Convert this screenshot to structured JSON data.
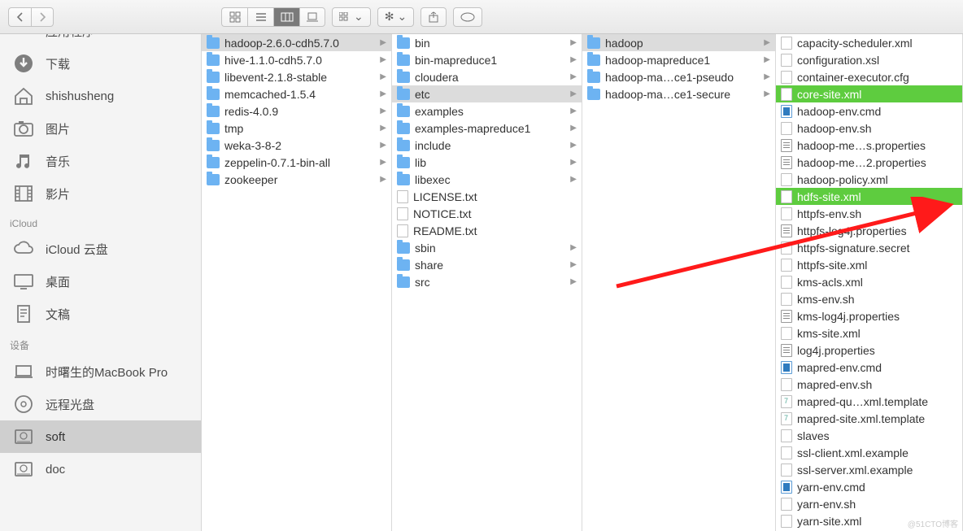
{
  "sidebar": {
    "icloud_header": "iCloud",
    "devices_header": "设备",
    "items": [
      {
        "label": "应用程序",
        "icon": "apps"
      },
      {
        "label": "下载",
        "icon": "download"
      },
      {
        "label": "shishusheng",
        "icon": "home"
      },
      {
        "label": "图片",
        "icon": "camera"
      },
      {
        "label": "音乐",
        "icon": "music"
      },
      {
        "label": "影片",
        "icon": "film"
      }
    ],
    "icloud_items": [
      {
        "label": "iCloud 云盘",
        "icon": "cloud"
      },
      {
        "label": "桌面",
        "icon": "desktop"
      },
      {
        "label": "文稿",
        "icon": "doc"
      }
    ],
    "device_items": [
      {
        "label": "时曙生的MacBook Pro",
        "icon": "laptop"
      },
      {
        "label": "远程光盘",
        "icon": "disc"
      },
      {
        "label": "soft",
        "icon": "hdd",
        "selected": true
      },
      {
        "label": "doc",
        "icon": "hdd"
      }
    ]
  },
  "columns": {
    "c1": [
      {
        "label": "hadoop-2.6.0-cdh5.7.0",
        "type": "folder",
        "selected": "grey",
        "arrow": true
      },
      {
        "label": "hive-1.1.0-cdh5.7.0",
        "type": "folder",
        "arrow": true
      },
      {
        "label": "libevent-2.1.8-stable",
        "type": "folder",
        "arrow": true
      },
      {
        "label": "memcached-1.5.4",
        "type": "folder",
        "arrow": true
      },
      {
        "label": "redis-4.0.9",
        "type": "folder",
        "arrow": true
      },
      {
        "label": "tmp",
        "type": "folder",
        "arrow": true
      },
      {
        "label": "weka-3-8-2",
        "type": "folder",
        "arrow": true
      },
      {
        "label": "zeppelin-0.7.1-bin-all",
        "type": "folder",
        "arrow": true
      },
      {
        "label": "zookeeper",
        "type": "folder",
        "arrow": true
      }
    ],
    "c2": [
      {
        "label": "bin",
        "type": "folder",
        "arrow": true
      },
      {
        "label": "bin-mapreduce1",
        "type": "folder",
        "arrow": true
      },
      {
        "label": "cloudera",
        "type": "folder",
        "arrow": true
      },
      {
        "label": "etc",
        "type": "folder",
        "selected": "grey",
        "arrow": true
      },
      {
        "label": "examples",
        "type": "folder",
        "arrow": true
      },
      {
        "label": "examples-mapreduce1",
        "type": "folder",
        "arrow": true
      },
      {
        "label": "include",
        "type": "folder",
        "arrow": true
      },
      {
        "label": "lib",
        "type": "folder",
        "arrow": true
      },
      {
        "label": "libexec",
        "type": "folder",
        "arrow": true
      },
      {
        "label": "LICENSE.txt",
        "type": "file"
      },
      {
        "label": "NOTICE.txt",
        "type": "file"
      },
      {
        "label": "README.txt",
        "type": "file"
      },
      {
        "label": "sbin",
        "type": "folder",
        "arrow": true
      },
      {
        "label": "share",
        "type": "folder",
        "arrow": true
      },
      {
        "label": "src",
        "type": "folder",
        "arrow": true
      }
    ],
    "c3": [
      {
        "label": "hadoop",
        "type": "folder",
        "selected": "grey",
        "arrow": true
      },
      {
        "label": "hadoop-mapreduce1",
        "type": "folder",
        "arrow": true
      },
      {
        "label": "hadoop-ma…ce1-pseudo",
        "type": "folder",
        "arrow": true
      },
      {
        "label": "hadoop-ma…ce1-secure",
        "type": "folder",
        "arrow": true
      }
    ],
    "c4": [
      {
        "label": "capacity-scheduler.xml",
        "type": "file"
      },
      {
        "label": "configuration.xsl",
        "type": "file"
      },
      {
        "label": "container-executor.cfg",
        "type": "file"
      },
      {
        "label": "core-site.xml",
        "type": "file",
        "selected": "green"
      },
      {
        "label": "hadoop-env.cmd",
        "type": "vscode"
      },
      {
        "label": "hadoop-env.sh",
        "type": "file"
      },
      {
        "label": "hadoop-me…s.properties",
        "type": "props"
      },
      {
        "label": "hadoop-me…2.properties",
        "type": "props"
      },
      {
        "label": "hadoop-policy.xml",
        "type": "file"
      },
      {
        "label": "hdfs-site.xml",
        "type": "file",
        "selected": "green"
      },
      {
        "label": "httpfs-env.sh",
        "type": "file"
      },
      {
        "label": "httpfs-log4j.properties",
        "type": "props"
      },
      {
        "label": "httpfs-signature.secret",
        "type": "file"
      },
      {
        "label": "httpfs-site.xml",
        "type": "file"
      },
      {
        "label": "kms-acls.xml",
        "type": "file"
      },
      {
        "label": "kms-env.sh",
        "type": "file"
      },
      {
        "label": "kms-log4j.properties",
        "type": "props"
      },
      {
        "label": "kms-site.xml",
        "type": "file"
      },
      {
        "label": "log4j.properties",
        "type": "props"
      },
      {
        "label": "mapred-env.cmd",
        "type": "vscode"
      },
      {
        "label": "mapred-env.sh",
        "type": "file"
      },
      {
        "label": "mapred-qu…xml.template",
        "type": "ini"
      },
      {
        "label": "mapred-site.xml.template",
        "type": "ini"
      },
      {
        "label": "slaves",
        "type": "file"
      },
      {
        "label": "ssl-client.xml.example",
        "type": "file"
      },
      {
        "label": "ssl-server.xml.example",
        "type": "file"
      },
      {
        "label": "yarn-env.cmd",
        "type": "vscode"
      },
      {
        "label": "yarn-env.sh",
        "type": "file"
      },
      {
        "label": "yarn-site.xml",
        "type": "file"
      }
    ]
  },
  "watermark": "@51CTO博客"
}
